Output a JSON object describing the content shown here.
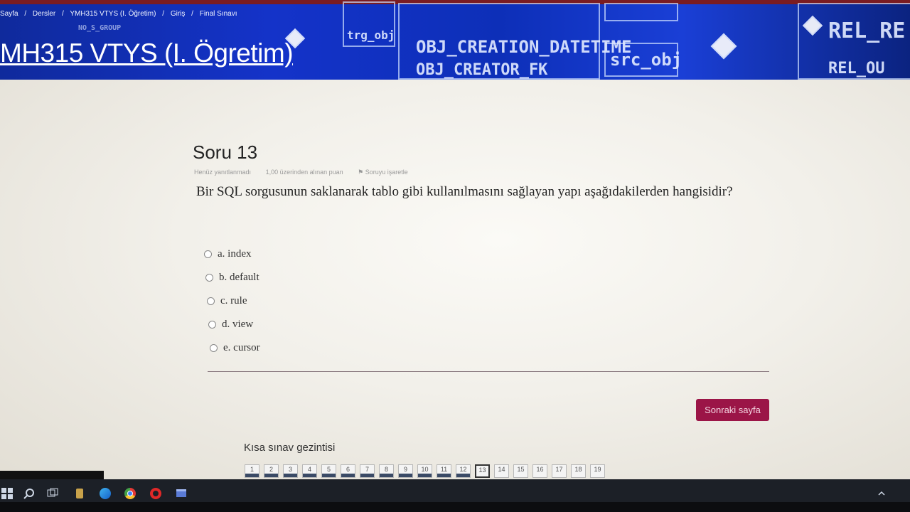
{
  "header": {
    "breadcrumbs": [
      "Sayfa",
      "/",
      "Dersler",
      "/",
      "YMH315 VTYS (I. Öğretim)",
      "/",
      "Giriş",
      "/",
      "Final Sınavı"
    ],
    "course_title": "MH315 VTYS (I. Ögretim)",
    "decor_text": [
      "OBJ_CREATION_DATETIME",
      "OBJ_CREATOR_FK",
      "src_obj",
      "trg_obj",
      "REL_RE",
      "NO_S_GROUP",
      "REL_OU"
    ]
  },
  "question": {
    "title": "Soru 13",
    "status": "Henüz yanıtlanmadı",
    "points": "1,00 üzerinden alınan puan",
    "flag": "Soruyu işaretle",
    "text": "Bir SQL sorgusunun saklanarak tablo gibi kullanılmasını sağlayan yapı aşağıdakilerden hangisidir?",
    "options": [
      {
        "label": "a. index"
      },
      {
        "label": "b. default"
      },
      {
        "label": "c. rule"
      },
      {
        "label": "d. view"
      },
      {
        "label": "e. cursor"
      }
    ]
  },
  "next_button": "Sonraki sayfa",
  "navigation": {
    "title": "Kısa sınav gezintisi",
    "current": 13,
    "answered_upto": 12,
    "items": [
      "1",
      "2",
      "3",
      "4",
      "5",
      "6",
      "7",
      "8",
      "9",
      "10",
      "11",
      "12",
      "13",
      "14",
      "15",
      "16",
      "17",
      "18",
      "19"
    ]
  },
  "colors": {
    "banner": "#1433c9",
    "button": "#9b1547",
    "background": "#f2f0ea"
  }
}
